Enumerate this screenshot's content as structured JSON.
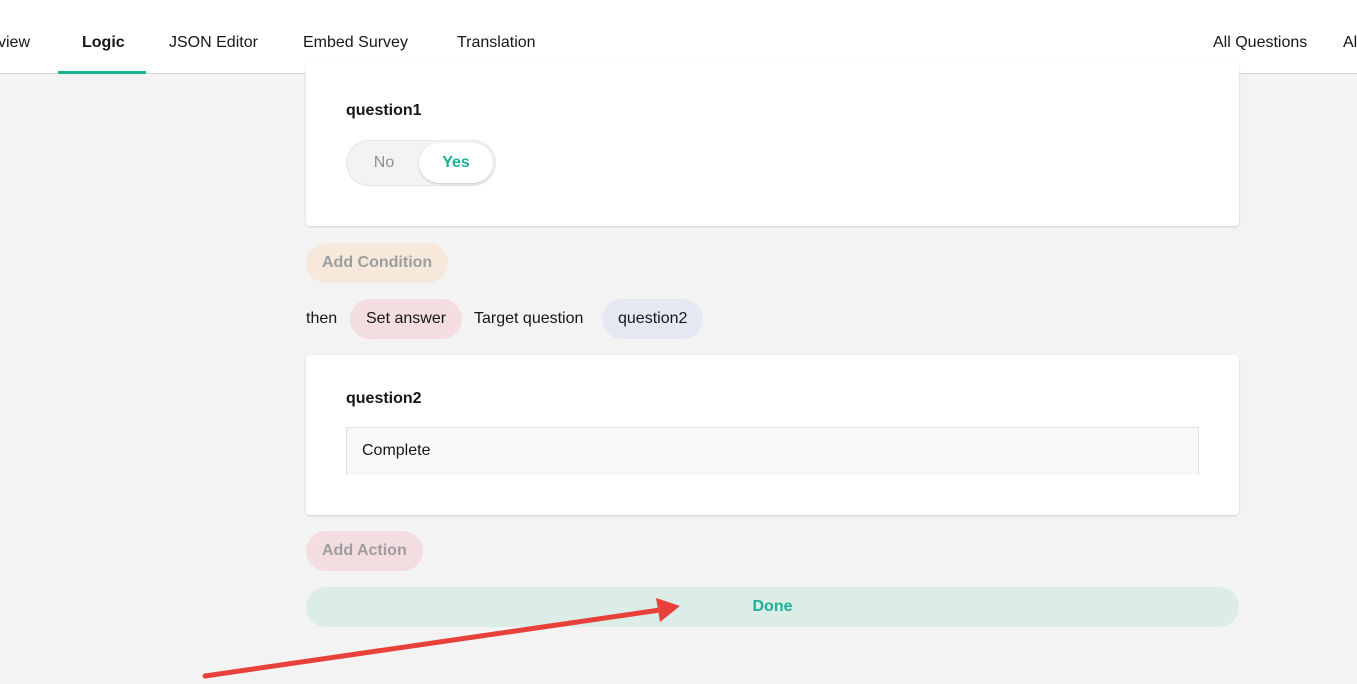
{
  "tabs": [
    {
      "label": "view",
      "active": false
    },
    {
      "label": "Logic",
      "active": true
    },
    {
      "label": "JSON Editor",
      "active": false
    },
    {
      "label": "Embed Survey",
      "active": false
    },
    {
      "label": "Translation",
      "active": false
    }
  ],
  "right_tabs": [
    {
      "label": "All Questions"
    },
    {
      "label": "Al"
    }
  ],
  "condition": {
    "question_title": "question1",
    "switch": {
      "no_label": "No",
      "yes_label": "Yes",
      "selected": "Yes"
    }
  },
  "add_condition_label": "Add Condition",
  "action": {
    "then_label": "then",
    "action_type": "Set answer",
    "target_label": "Target question",
    "target_question": "question2",
    "question_title": "question2",
    "answer_value": "Complete"
  },
  "add_action_label": "Add Action",
  "done_label": "Done",
  "colors": {
    "accent": "#19b394",
    "condition_pill": "#f6e9dc",
    "action_pill": "#f3dde1",
    "question_pill": "#e3e8f3",
    "done_bg": "#dcede8",
    "annotation_arrow": "#e8403a"
  }
}
